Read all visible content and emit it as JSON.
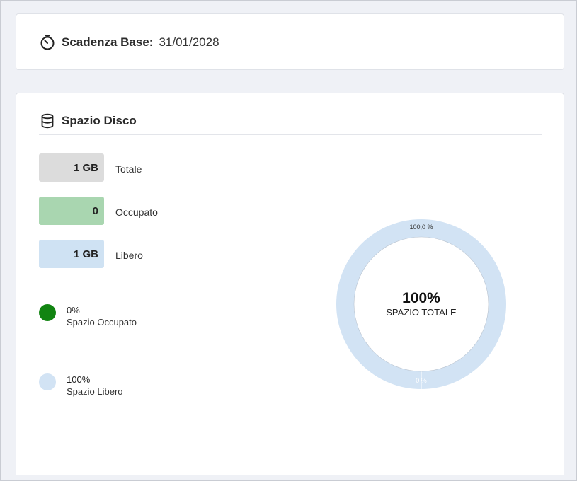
{
  "expiry": {
    "label": "Scadenza Base:",
    "value": "31/01/2028",
    "icon": "stopwatch-icon"
  },
  "disk": {
    "title": "Spazio Disco",
    "icon": "database-icon",
    "stats": [
      {
        "value": "1 GB",
        "label": "Totale",
        "color": "#dcdcdc"
      },
      {
        "value": "0",
        "label": "Occupato",
        "color": "#a9d6b0"
      },
      {
        "value": "1 GB",
        "label": "Libero",
        "color": "#cfe2f3"
      }
    ],
    "legend": [
      {
        "percent": "0%",
        "label": "Spazio Occupato",
        "color": "#118411"
      },
      {
        "percent": "100%",
        "label": "Spazio Libero",
        "color": "#d2e3f4"
      }
    ]
  },
  "chart_data": {
    "type": "pie",
    "categories": [
      "Spazio Libero",
      "Spazio Occupato"
    ],
    "values": [
      100.0,
      0.0
    ],
    "slice_labels": [
      "100,0 %",
      "0 %"
    ],
    "center_value": "100%",
    "center_label": "SPAZIO TOTALE",
    "colors": [
      "#d2e3f4",
      "#118411"
    ]
  }
}
